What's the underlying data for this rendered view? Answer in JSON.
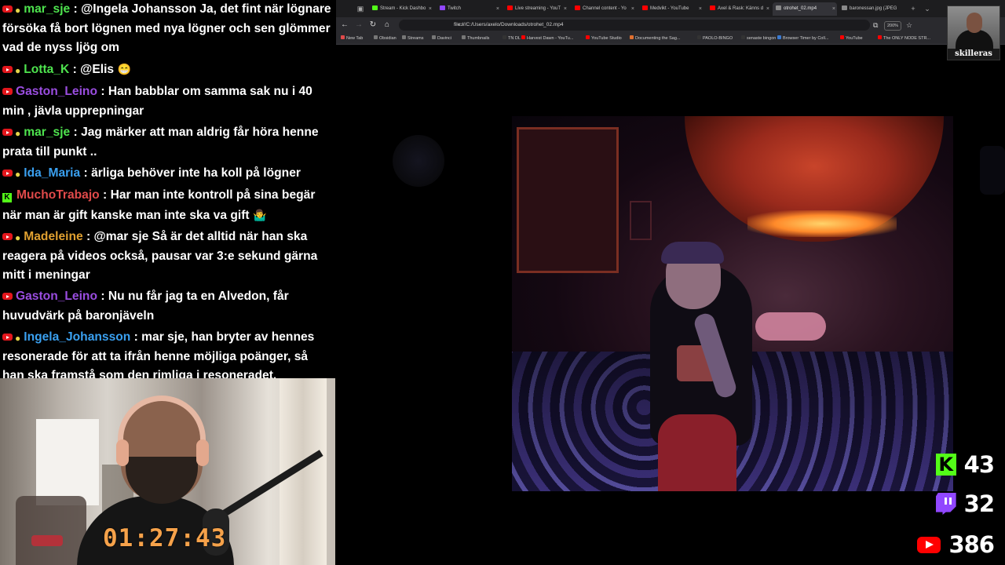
{
  "chat": {
    "messages": [
      {
        "user": "mar_sje",
        "color": "#4ee34e",
        "badges": [
          "youtube",
          "bulb"
        ],
        "text": "@Ingela Johansson Ja, det fint när lögnare försöka få bort lögnen med nya lögner och sen glömmer vad de nyss ljög om"
      },
      {
        "user": "Lotta_K",
        "color": "#4ee34e",
        "badges": [
          "youtube",
          "bulb"
        ],
        "text": "@Elis",
        "emoji": "😁"
      },
      {
        "user": "Gaston_Leino",
        "color": "#9a4de0",
        "badges": [
          "youtube"
        ],
        "text": "Han babblar om samma sak nu i 40 min , jävla upprepningar"
      },
      {
        "user": "mar_sje",
        "color": "#4ee34e",
        "badges": [
          "youtube",
          "bulb"
        ],
        "text": "Jag märker att man aldrig får höra henne prata till punkt .."
      },
      {
        "user": "Ida_Maria",
        "color": "#3aa0f0",
        "badges": [
          "youtube",
          "bulb"
        ],
        "text": "ärliga behöver inte ha koll på lögner"
      },
      {
        "user": "MuchoTrabajo",
        "color": "#e04a4a",
        "badges": [
          "kick"
        ],
        "text": "Har man inte kontroll på sina begär när man är gift kanske man inte ska va gift",
        "emoji": "🤷‍♂️"
      },
      {
        "user": "Madeleine",
        "color": "#e0a030",
        "badges": [
          "youtube",
          "bulb"
        ],
        "text": "@mar sje Så är det alltid när han ska reagera på videos också, pausar var 3:e sekund gärna mitt i meningar"
      },
      {
        "user": "Gaston_Leino",
        "color": "#9a4de0",
        "badges": [
          "youtube"
        ],
        "text": "Nu nu får jag ta en Alvedon, får huvudvärk på baronjäveln"
      },
      {
        "user": "Ingela_Johansson",
        "color": "#3aa0f0",
        "badges": [
          "youtube",
          "bulb"
        ],
        "text": "mar sje, han bryter av hennes resonerade för att ta ifrån henne möjliga poänger, så han ska framstå som den rimliga i resoneradet. genomskinligt"
      }
    ]
  },
  "webcam": {
    "timer": "01:27:43"
  },
  "browser": {
    "tabs": [
      {
        "label": "Stream - Kick Dashbo",
        "fav": "#53fc18"
      },
      {
        "label": "Twitch",
        "fav": "#9147ff"
      },
      {
        "label": "Live streaming - YouT",
        "fav": "#ff0000"
      },
      {
        "label": "Channel content - Yo",
        "fav": "#ff0000"
      },
      {
        "label": "Medvikt - YouTube",
        "fav": "#ff0000"
      },
      {
        "label": "Axel & Rask: Känns d",
        "fav": "#ff0000"
      },
      {
        "label": "otrohet_02.mp4",
        "fav": "#8a8a8a",
        "active": true
      },
      {
        "label": "baronessan.jpg (JPEG bild",
        "fav": "#8a8a8a"
      }
    ],
    "url": "file:///C:/Users/axelo/Downloads/otrohet_02.mp4",
    "zoom": "200%",
    "bookmarks": [
      {
        "label": "New Tab",
        "fav": "#e04a4a"
      },
      {
        "label": "Obsidian",
        "fav": "#777777"
      },
      {
        "label": "Streams",
        "fav": "#777777"
      },
      {
        "label": "Davinci",
        "fav": "#777777"
      },
      {
        "label": "Thumbnails",
        "fav": "#777777"
      },
      {
        "label": "TN DL",
        "fav": "#333333"
      },
      {
        "label": "Harvest Dawn - YouTu...",
        "fav": "#ff0000"
      },
      {
        "label": "YouTube Studio",
        "fav": "#ff0000"
      },
      {
        "label": "Documenting the Sag...",
        "fav": "#e07030"
      },
      {
        "label": "PAOLO-BINGO",
        "fav": "#333333"
      },
      {
        "label": "senaste bingon",
        "fav": "#333333"
      },
      {
        "label": "Browser Timer by Coll...",
        "fav": "#3a7ad0"
      },
      {
        "label": "YouTube",
        "fav": "#ff0000"
      },
      {
        "label": "The ONLY NODE STR...",
        "fav": "#ff0000"
      }
    ]
  },
  "overlay": {
    "streamer_name": "skilleras",
    "counts": [
      {
        "platform": "kick",
        "icon": "kick-icon",
        "value": "43"
      },
      {
        "platform": "twitch",
        "icon": "twitch-icon",
        "value": "32"
      },
      {
        "platform": "youtube",
        "icon": "youtube-icon",
        "value": "386"
      }
    ]
  }
}
